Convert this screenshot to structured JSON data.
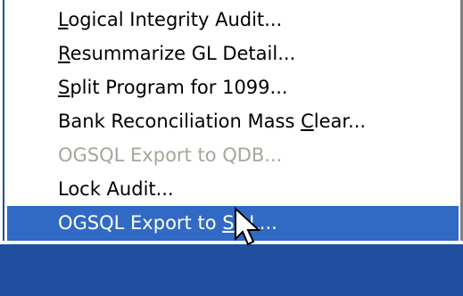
{
  "menu": {
    "items": [
      {
        "pre": "",
        "accel": "L",
        "post": "ogical Integrity Audit...",
        "state": "normal"
      },
      {
        "pre": "",
        "accel": "R",
        "post": "esummarize GL Detail...",
        "state": "normal"
      },
      {
        "pre": "",
        "accel": "S",
        "post": "plit Program for 1099...",
        "state": "normal"
      },
      {
        "pre": "Bank Reconciliation Mass ",
        "accel": "C",
        "post": "lear...",
        "state": "normal"
      },
      {
        "pre": "OGSQL Export to QDB...",
        "accel": "",
        "post": "",
        "state": "disabled"
      },
      {
        "pre": "Lock Audit...",
        "accel": "",
        "post": "",
        "state": "normal"
      },
      {
        "pre": "OGSQL Export to ",
        "accel": "S",
        "post": "QL...",
        "state": "selected"
      }
    ]
  },
  "colors": {
    "selection": "#316ac5",
    "disabled_text": "#a7a69c",
    "taskbar": "#1f4f9e"
  },
  "icons": {
    "cursor": "arrow-cursor-icon"
  }
}
